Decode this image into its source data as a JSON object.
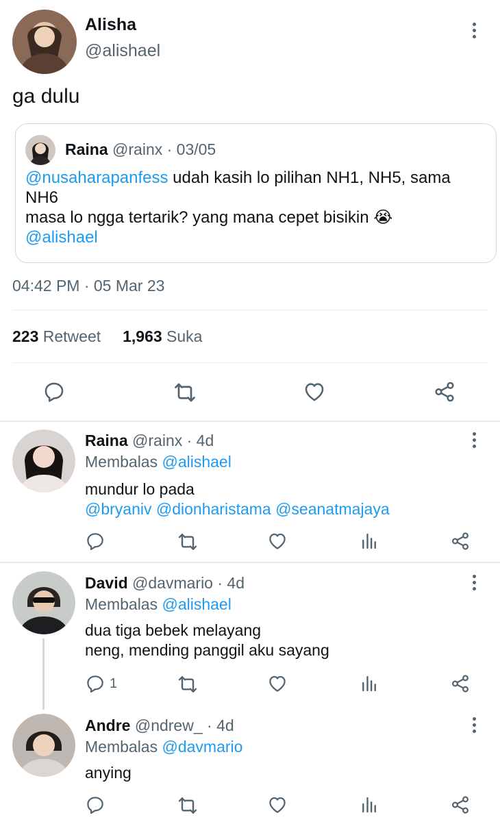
{
  "main_tweet": {
    "author_name": "Alisha",
    "author_handle": "@alishael",
    "text": "ga dulu",
    "timestamp": "04:42 PM · 05 Mar 23",
    "retweets_count": "223",
    "retweets_label": "Retweet",
    "likes_count": "1,963",
    "likes_label": "Suka"
  },
  "quoted_tweet": {
    "author_name": "Raina",
    "handle_date": "@rainx · 03/05",
    "mention": "@nusaharapanfess",
    "text_1": " udah kasih lo pilihan NH1, NH5, sama NH6",
    "text_2": "masa lo ngga tertarik? yang mana cepet bisikin 😭",
    "mention_2": "@alishael"
  },
  "replies": [
    {
      "name": "Raina",
      "handle_time": "@rainx · 4d",
      "replying_prefix": "Membalas ",
      "replying_to": "@alishael",
      "line_1": "mundur lo pada",
      "line_2": "@bryaniv @dionharistama @seanatmajaya",
      "reply_count": ""
    },
    {
      "name": "David",
      "handle_time": "@davmario · 4d",
      "replying_prefix": "Membalas ",
      "replying_to": "@alishael",
      "line_1": "dua tiga bebek melayang",
      "line_2": "neng, mending panggil aku sayang",
      "reply_count": "1"
    },
    {
      "name": "Andre",
      "handle_time": "@ndrew_ · 4d",
      "replying_prefix": "Membalas ",
      "replying_to": "@davmario",
      "line_1": "anying",
      "line_2": "",
      "reply_count": ""
    }
  ],
  "icons": {
    "reply": "reply-icon",
    "retweet": "retweet-icon",
    "like": "heart-icon",
    "views": "views-icon",
    "share": "share-icon",
    "more": "more-icon"
  },
  "colors": {
    "link": "#1d9bf0",
    "muted": "#536471",
    "text": "#0f1419",
    "border": "#cfd9de"
  }
}
